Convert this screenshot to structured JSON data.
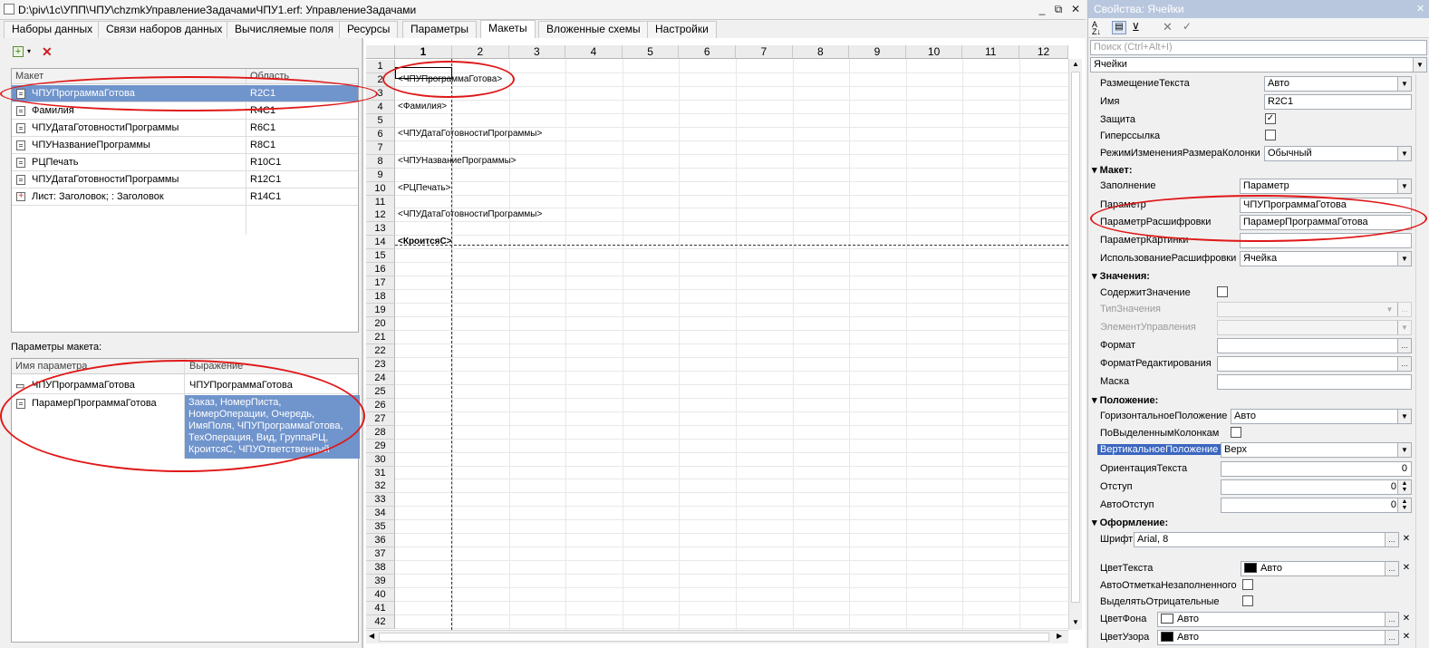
{
  "window": {
    "title": "D:\\piv\\1c\\УПП\\ЧПУ\\chzmkУправлениеЗадачамиЧПУ1.erf: УправлениеЗадачами",
    "minimize": "_",
    "restore": "⧉",
    "close": "✕"
  },
  "tabs": [
    "Наборы данных",
    "Связи наборов данных",
    "Вычисляемые поля",
    "Ресурсы",
    "Параметры",
    "Макеты",
    "Вложенные схемы",
    "Настройки"
  ],
  "layouts_grid": {
    "headers": [
      "Макет",
      "Область"
    ],
    "rows": [
      {
        "name": "ЧПУПрограммаГотова",
        "area": "R2C1"
      },
      {
        "name": "Фамилия",
        "area": "R4C1"
      },
      {
        "name": "ЧПУДатаГотовностиПрограммы",
        "area": "R6C1"
      },
      {
        "name": "ЧПУНазваниеПрограммы",
        "area": "R8C1"
      },
      {
        "name": "РЦПечать",
        "area": "R10C1"
      },
      {
        "name": "ЧПУДатаГотовностиПрограммы",
        "area": "R12C1"
      },
      {
        "name": "Лист: Заголовок; : Заголовок",
        "area": "R14C1"
      }
    ]
  },
  "params_section": {
    "label": "Параметры макета:",
    "headers": [
      "Имя параметра",
      "Выражение"
    ],
    "rows": [
      {
        "name": "ЧПУПрограммаГотова",
        "expr": "ЧПУПрограммаГотова"
      },
      {
        "name": "ПарамерПрограммаГотова",
        "expr_lines": [
          "Заказ, НомерПиста,",
          "НомерОперации, Очередь,",
          "ИмяПоля, ЧПУПрограммаГотова,",
          "ТехОперация, Вид, ГруппаРЦ,",
          "КроитсяС, ЧПУОтветственный"
        ]
      }
    ]
  },
  "sheet": {
    "columns": [
      "1",
      "2",
      "3",
      "4",
      "5",
      "6",
      "7",
      "8",
      "9",
      "10",
      "11",
      "12"
    ],
    "rows": [
      "1",
      "2",
      "3",
      "4",
      "5",
      "6",
      "7",
      "8",
      "9",
      "10",
      "11",
      "12",
      "13",
      "14",
      "15",
      "16",
      "17",
      "18",
      "19",
      "20",
      "21",
      "22",
      "23",
      "24",
      "25",
      "26",
      "27",
      "28",
      "29",
      "30",
      "31",
      "32",
      "33",
      "34",
      "35",
      "36",
      "37",
      "38",
      "39",
      "40",
      "41",
      "42"
    ],
    "cells": [
      {
        "row": "2",
        "text": "<ЧПУПрограммаГотова>"
      },
      {
        "row": "4",
        "text": "<Фамилия>"
      },
      {
        "row": "6",
        "text": "<ЧПУДатаГотовностиПрограммы>"
      },
      {
        "row": "8",
        "text": "<ЧПУНазваниеПрограммы>"
      },
      {
        "row": "10",
        "text": "<РЦПечать>"
      },
      {
        "row": "12",
        "text": "<ЧПУДатаГотовностиПрограммы>"
      },
      {
        "row": "14",
        "text": "<КроитсяС>"
      }
    ]
  },
  "props": {
    "title": "Свойства: Ячейки",
    "search_placeholder": "Поиск (Ctrl+Alt+I)",
    "object": "Ячейки",
    "items": {
      "text_placement": {
        "label": "РазмещениеТекста",
        "value": "Авто"
      },
      "name": {
        "label": "Имя",
        "value": "R2C1"
      },
      "protection": {
        "label": "Защита",
        "check": "✓"
      },
      "hyperlink": {
        "label": "Гиперссылка"
      },
      "resize_mode": {
        "label": "РежимИзмененияРазмераКолонки",
        "value": "Обычный"
      },
      "grp_layout": "Макет:",
      "fill": {
        "label": "Заполнение",
        "value": "Параметр"
      },
      "param": {
        "label": "Параметр",
        "value": "ЧПУПрограммаГотова"
      },
      "decode_param": {
        "label": "ПараметрРасшифровки",
        "value": "ПарамерПрограммаГотова"
      },
      "picture_param": {
        "label": "ПараметрКартинки",
        "value": ""
      },
      "decode_use": {
        "label": "ИспользованиеРасшифровки",
        "value": "Ячейка"
      },
      "grp_values": "Значения:",
      "contains_value": {
        "label": "СодержитЗначение"
      },
      "value_type": {
        "label": "ТипЗначения"
      },
      "control": {
        "label": "ЭлементУправления"
      },
      "format": {
        "label": "Формат"
      },
      "edit_format": {
        "label": "ФорматРедактирования"
      },
      "mask": {
        "label": "Маска"
      },
      "grp_position": "Положение:",
      "h_pos": {
        "label": "ГоризонтальноеПоложение",
        "value": "Авто"
      },
      "by_selected": {
        "label": "ПоВыделеннымКолонкам"
      },
      "v_pos": {
        "label": "ВертикальноеПоложение",
        "value": "Верх"
      },
      "orientation": {
        "label": "ОриентацияТекста",
        "value": "0"
      },
      "indent": {
        "label": "Отступ",
        "value": "0"
      },
      "auto_indent": {
        "label": "АвтоОтступ",
        "value": "0"
      },
      "grp_design": "Оформление:",
      "font": {
        "label": "Шрифт",
        "value": "Arial, 8"
      },
      "text_color": {
        "label": "ЦветТекста",
        "value": "Авто",
        "swatch": "#000000"
      },
      "auto_mark": {
        "label": "АвтоОтметкаНезаполненного"
      },
      "highlight_neg": {
        "label": "ВыделятьОтрицательные"
      },
      "bg_color": {
        "label": "ЦветФона",
        "value": "Авто",
        "swatch": "#ffffff"
      },
      "pattern_color": {
        "label": "ЦветУзора",
        "value": "Авто",
        "swatch": "#000000"
      }
    }
  },
  "colors": {
    "selection": "#7094cc",
    "annotation": "#e01818",
    "titlebar": "#b8c7de"
  }
}
